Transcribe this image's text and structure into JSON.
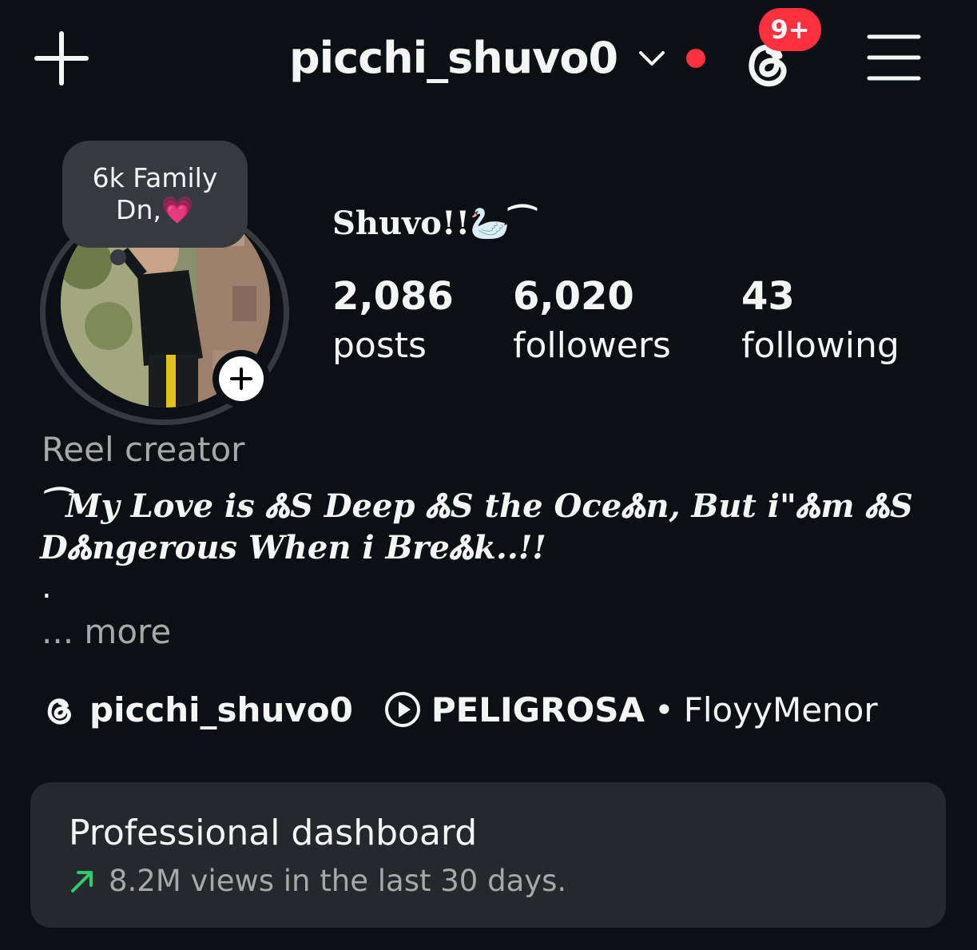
{
  "header": {
    "username": "picchi_shuvo0",
    "notification_badge": "9+",
    "accent_red": "#ff3040"
  },
  "profile": {
    "note_line1": "6k Family",
    "note_line2": "Dn,💗",
    "display_name": "Shuvo!!🦢⁀",
    "stats": {
      "posts_count": "2,086",
      "posts_label": "posts",
      "followers_count": "6,020",
      "followers_label": "followers",
      "following_count": "43",
      "following_label": "following"
    },
    "category": "Reel creator",
    "bio_line1": "⁀My Love is ᏜS Deep ᏜS the OceᏜn, But i\"Ꮬm ᏜS",
    "bio_line2": "DᏜngerous When i BreᏜk..!!",
    "bio_dot": ".",
    "more_label": "... more",
    "threads_handle": "picchi_shuvo0",
    "song_title": "PELIGROSA",
    "song_separator": "•",
    "song_artist": "FloyyMenor"
  },
  "dashboard": {
    "title": "Professional dashboard",
    "subtitle": "8.2M views in the last 30 days.",
    "trend_color": "#2ecc71"
  },
  "icons": [
    "plus-icon",
    "chevron-down-icon",
    "threads-icon",
    "hamburger-menu-icon",
    "add-story-icon",
    "play-circle-icon",
    "trend-up-icon"
  ]
}
